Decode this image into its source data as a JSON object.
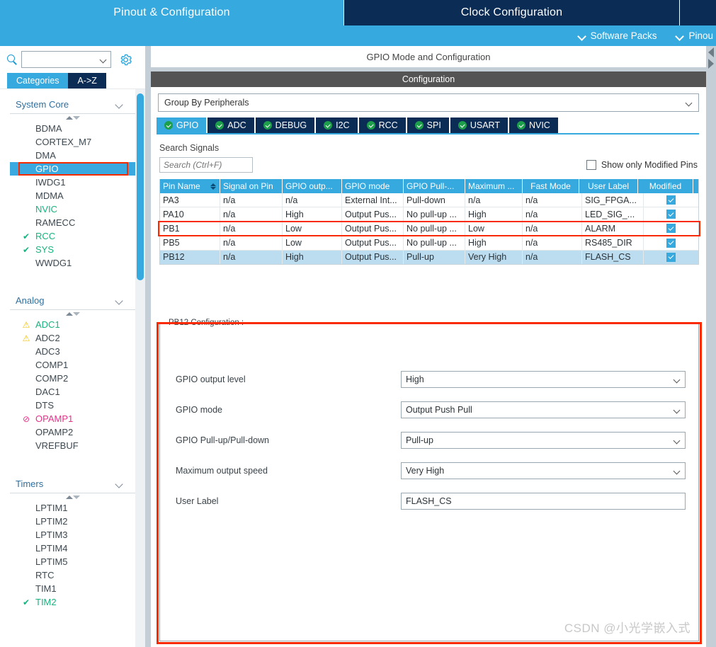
{
  "window": {
    "main_tabs": [
      {
        "label": "Pinout & Configuration",
        "state": "active"
      },
      {
        "label": "Clock Configuration",
        "state": "inactive"
      },
      {
        "label": "",
        "state": "inactive"
      }
    ],
    "quick_links": [
      {
        "label": "Software Packs",
        "icon": "chevron-down-icon"
      },
      {
        "label": "Pinou",
        "icon": "chevron-down-icon"
      }
    ]
  },
  "sidebar": {
    "search": {
      "value": "",
      "placeholder": "",
      "icon": "search-icon"
    },
    "settings_icon": "gear-icon",
    "view_tabs": [
      {
        "label": "Categories",
        "state": "active"
      },
      {
        "label": "A->Z",
        "state": "inactive"
      }
    ],
    "groups": [
      {
        "title": "System Core",
        "items": [
          {
            "label": "BDMA",
            "status": "none"
          },
          {
            "label": "CORTEX_M7",
            "status": "none"
          },
          {
            "label": "DMA",
            "status": "none"
          },
          {
            "label": "GPIO",
            "status": "selected"
          },
          {
            "label": "IWDG1",
            "status": "none"
          },
          {
            "label": "MDMA",
            "status": "none"
          },
          {
            "label": "NVIC",
            "status": "green"
          },
          {
            "label": "RAMECC",
            "status": "none"
          },
          {
            "label": "RCC",
            "status": "check"
          },
          {
            "label": "SYS",
            "status": "check"
          },
          {
            "label": "WWDG1",
            "status": "none"
          }
        ]
      },
      {
        "title": "Analog",
        "items": [
          {
            "label": "ADC1",
            "status": "warn-green"
          },
          {
            "label": "ADC2",
            "status": "warn"
          },
          {
            "label": "ADC3",
            "status": "none"
          },
          {
            "label": "COMP1",
            "status": "none"
          },
          {
            "label": "COMP2",
            "status": "none"
          },
          {
            "label": "DAC1",
            "status": "none"
          },
          {
            "label": "DTS",
            "status": "none"
          },
          {
            "label": "OPAMP1",
            "status": "blocked"
          },
          {
            "label": "OPAMP2",
            "status": "none"
          },
          {
            "label": "VREFBUF",
            "status": "none"
          }
        ]
      },
      {
        "title": "Timers",
        "items": [
          {
            "label": "LPTIM1",
            "status": "none"
          },
          {
            "label": "LPTIM2",
            "status": "none"
          },
          {
            "label": "LPTIM3",
            "status": "none"
          },
          {
            "label": "LPTIM4",
            "status": "none"
          },
          {
            "label": "LPTIM5",
            "status": "none"
          },
          {
            "label": "RTC",
            "status": "none"
          },
          {
            "label": "TIM1",
            "status": "none"
          },
          {
            "label": "TIM2",
            "status": "check"
          }
        ]
      }
    ]
  },
  "main": {
    "mode_header": "GPIO Mode and Configuration",
    "config_header": "Configuration",
    "group_by": {
      "value": "Group By Peripherals"
    },
    "peripheral_tabs": [
      {
        "label": "GPIO",
        "state": "active",
        "icon": "check-circle-icon"
      },
      {
        "label": "ADC",
        "state": "inactive",
        "icon": "check-circle-icon"
      },
      {
        "label": "DEBUG",
        "state": "inactive",
        "icon": "check-circle-icon"
      },
      {
        "label": "I2C",
        "state": "inactive",
        "icon": "check-circle-icon"
      },
      {
        "label": "RCC",
        "state": "inactive",
        "icon": "check-circle-icon"
      },
      {
        "label": "SPI",
        "state": "inactive",
        "icon": "check-circle-icon"
      },
      {
        "label": "USART",
        "state": "inactive",
        "icon": "check-circle-icon"
      },
      {
        "label": "NVIC",
        "state": "inactive",
        "icon": "check-circle-icon"
      }
    ],
    "search_signals": {
      "label": "Search Signals",
      "input_placeholder": "Search (Ctrl+F)",
      "input_value": ""
    },
    "show_modified": {
      "label": "Show only Modified Pins",
      "checked": false
    },
    "table": {
      "headers": [
        "Pin Name",
        "Signal on Pin",
        "GPIO outp...",
        "GPIO mode",
        "GPIO Pull-...",
        "Maximum ...",
        "Fast Mode",
        "User Label",
        "Modified"
      ],
      "rows": [
        {
          "cells": [
            "PA3",
            "n/a",
            "n/a",
            "External Int...",
            "Pull-down",
            "n/a",
            "n/a",
            "SIG_FPGA..."
          ],
          "modified": true,
          "selected": false
        },
        {
          "cells": [
            "PA10",
            "n/a",
            "High",
            "Output Pus...",
            "No pull-up ...",
            "High",
            "n/a",
            "LED_SIG_..."
          ],
          "modified": true,
          "selected": false
        },
        {
          "cells": [
            "PB1",
            "n/a",
            "Low",
            "Output Pus...",
            "No pull-up ...",
            "Low",
            "n/a",
            "ALARM"
          ],
          "modified": true,
          "selected": false
        },
        {
          "cells": [
            "PB5",
            "n/a",
            "Low",
            "Output Pus...",
            "No pull-up ...",
            "High",
            "n/a",
            "RS485_DIR"
          ],
          "modified": true,
          "selected": false
        },
        {
          "cells": [
            "PB12",
            "n/a",
            "High",
            "Output Pus...",
            "Pull-up",
            "Very High",
            "n/a",
            "FLASH_CS"
          ],
          "modified": true,
          "selected": true
        }
      ]
    },
    "pin_config": {
      "legend": "PB12 Configuration :",
      "fields": [
        {
          "label": "GPIO output level",
          "value": "High",
          "type": "select"
        },
        {
          "label": "GPIO mode",
          "value": "Output Push Pull",
          "type": "select"
        },
        {
          "label": "GPIO Pull-up/Pull-down",
          "value": "Pull-up",
          "type": "select"
        },
        {
          "label": "Maximum output speed",
          "value": "Very High",
          "type": "select"
        },
        {
          "label": "User Label",
          "value": "FLASH_CS",
          "type": "text"
        }
      ]
    },
    "watermark": "CSDN @小光学嵌入式"
  },
  "colors": {
    "accent": "#36a9df",
    "dark_navy": "#0b2d55",
    "highlight_red": "#fa2a00",
    "ok_green": "#16b37f",
    "warn_yellow": "#f2c200",
    "block_pink": "#e8308a"
  }
}
